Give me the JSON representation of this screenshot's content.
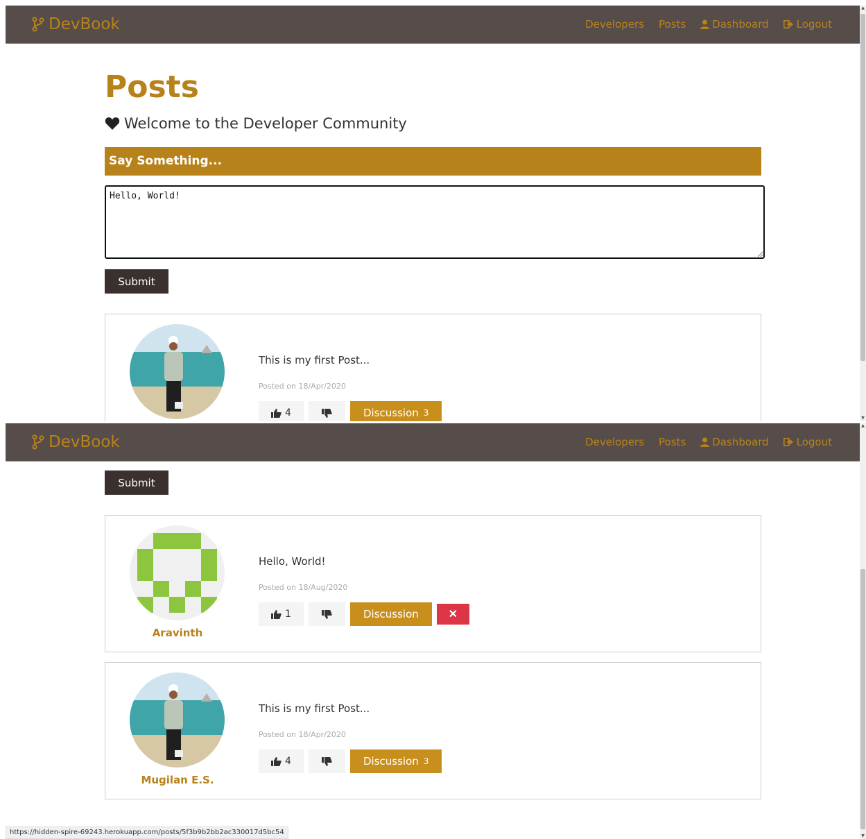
{
  "navbar": {
    "brand": "DevBook",
    "links": {
      "developers": "Developers",
      "posts": "Posts",
      "dashboard": "Dashboard",
      "logout": "Logout"
    }
  },
  "page": {
    "title": "Posts",
    "lead": "Welcome to the Developer Community"
  },
  "form": {
    "header": "Say Something...",
    "textarea_value": "Hello, World!",
    "submit_label": "Submit"
  },
  "posts_top": [
    {
      "text": "This is my first Post...",
      "date": "Posted on 18/Apr/2020",
      "likes": "4",
      "discussion_label": "Discussion",
      "discussion_count": "3"
    }
  ],
  "posts_bottom": [
    {
      "author": "Aravinth",
      "text": "Hello, World!",
      "date": "Posted on 18/Aug/2020",
      "likes": "1",
      "discussion_label": "Discussion",
      "delete_label": "✕"
    },
    {
      "author": "Mugilan E.S.",
      "text": "This is my first Post...",
      "date": "Posted on 18/Apr/2020",
      "likes": "4",
      "discussion_label": "Discussion",
      "discussion_count": "3"
    }
  ],
  "status_bar": {
    "url": "https://hidden-spire-69243.herokuapp.com/posts/5f3b9b2bb2ac330017d5bc54"
  },
  "colors": {
    "accent": "#b8821a",
    "navbar_bg": "#564d4a",
    "dark_button": "#3a302d",
    "danger": "#dc3545"
  }
}
